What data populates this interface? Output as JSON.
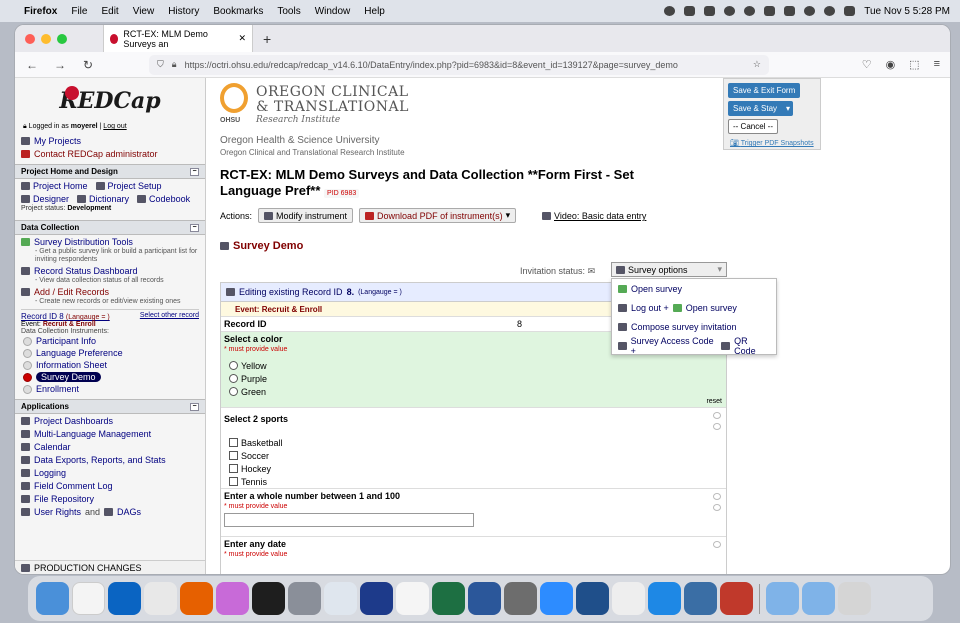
{
  "menubar": {
    "app": "Firefox",
    "items": [
      "File",
      "Edit",
      "View",
      "History",
      "Bookmarks",
      "Tools",
      "Window",
      "Help"
    ],
    "datetime": "Tue Nov 5  5:28 PM"
  },
  "browser": {
    "tab_title": "RCT-EX: MLM Demo Surveys an",
    "url": "https://octri.ohsu.edu/redcap/redcap_v14.6.10/DataEntry/index.php?pid=6983&id=8&event_id=139127&page=survey_demo"
  },
  "sidebar": {
    "logo": "REDCap",
    "login_prefix": "Logged in as",
    "user": "moyerel",
    "logout": "Log out",
    "my_projects": "My Projects",
    "contact_admin": "Contact REDCap administrator",
    "section_home": "Project Home and Design",
    "project_home": "Project Home",
    "project_setup": "Project Setup",
    "designer": "Designer",
    "dictionary": "Dictionary",
    "codebook": "Codebook",
    "status_label": "Project status:",
    "status_value": "Development",
    "section_collection": "Data Collection",
    "survey_tools": "Survey Distribution Tools",
    "survey_tools_desc": "- Get a public survey link or build a participant list for inviting respondents",
    "record_dashboard": "Record Status Dashboard",
    "record_dashboard_desc": "- View data collection status of all records",
    "add_edit": "Add / Edit Records",
    "add_edit_desc": "- Create new records or edit/view existing ones",
    "record_id": "Record ID 8",
    "language": "(Langauge = )",
    "select_other": "Select other record",
    "event_label": "Event:",
    "event_value": "Recruit & Enroll",
    "instruments_label": "Data Collection Instruments:",
    "instruments": [
      "Participant Info",
      "Language Preference",
      "Information Sheet",
      "Survey Demo",
      "Enrollment"
    ],
    "section_apps": "Applications",
    "apps": [
      "Project Dashboards",
      "Multi-Language Management",
      "Calendar",
      "Data Exports, Reports, and Stats",
      "Logging",
      "Field Comment Log",
      "File Repository",
      "User Rights",
      "DAGs"
    ],
    "apps_and": "and",
    "production": "PRODUCTION CHANGES"
  },
  "header": {
    "org_line1": "OREGON CLINICAL",
    "org_line2": "& TRANSLATIONAL",
    "org_line3": "Research Institute",
    "ohsu": "OHSU",
    "univ": "Oregon Health & Science University",
    "institute": "Oregon Clinical and Translational Research Institute"
  },
  "buttons": {
    "save_exit": "Save & Exit Form",
    "save_stay": "Save & Stay",
    "cancel": "-- Cancel --",
    "trigger": "Trigger PDF Snapshots"
  },
  "page": {
    "title": "RCT-EX: MLM Demo Surveys and Data Collection **Form First - Set Language Pref**",
    "pid": "PID 6983",
    "actions_label": "Actions:",
    "modify": "Modify instrument",
    "download": "Download PDF of instrument(s)",
    "video": "Video: Basic data entry",
    "survey_title": "Survey Demo",
    "invitation_label": "Invitation status:",
    "survey_options": "Survey options",
    "dropdown": {
      "open": "Open survey",
      "logout": "Log out +",
      "logout_open": "Open survey",
      "compose": "Compose survey invitation",
      "access_code": "Survey Access Code +",
      "qr": "QR Code"
    }
  },
  "form": {
    "editing": "Editing existing Record ID",
    "record_num": "8.",
    "lang": "(Langauge = )",
    "event": "Event:",
    "event_value": "Recruit & Enroll",
    "record_label": "Record ID",
    "record_value": "8",
    "q1": {
      "label": "Select a color",
      "req": "* must provide value",
      "options": [
        "Yellow",
        "Purple",
        "Green"
      ],
      "reset": "reset"
    },
    "q2": {
      "label": "Select 2 sports",
      "options": [
        "Basketball",
        "Soccer",
        "Hockey",
        "Tennis"
      ]
    },
    "q3": {
      "label": "Enter a whole number between 1 and 100",
      "req": "* must provide value"
    },
    "q4": {
      "label": "Enter any date",
      "req": "* must provide value"
    }
  },
  "colors": {
    "accent": "#337ab7",
    "brand_red": "#c8102e",
    "nav": "#000080"
  }
}
